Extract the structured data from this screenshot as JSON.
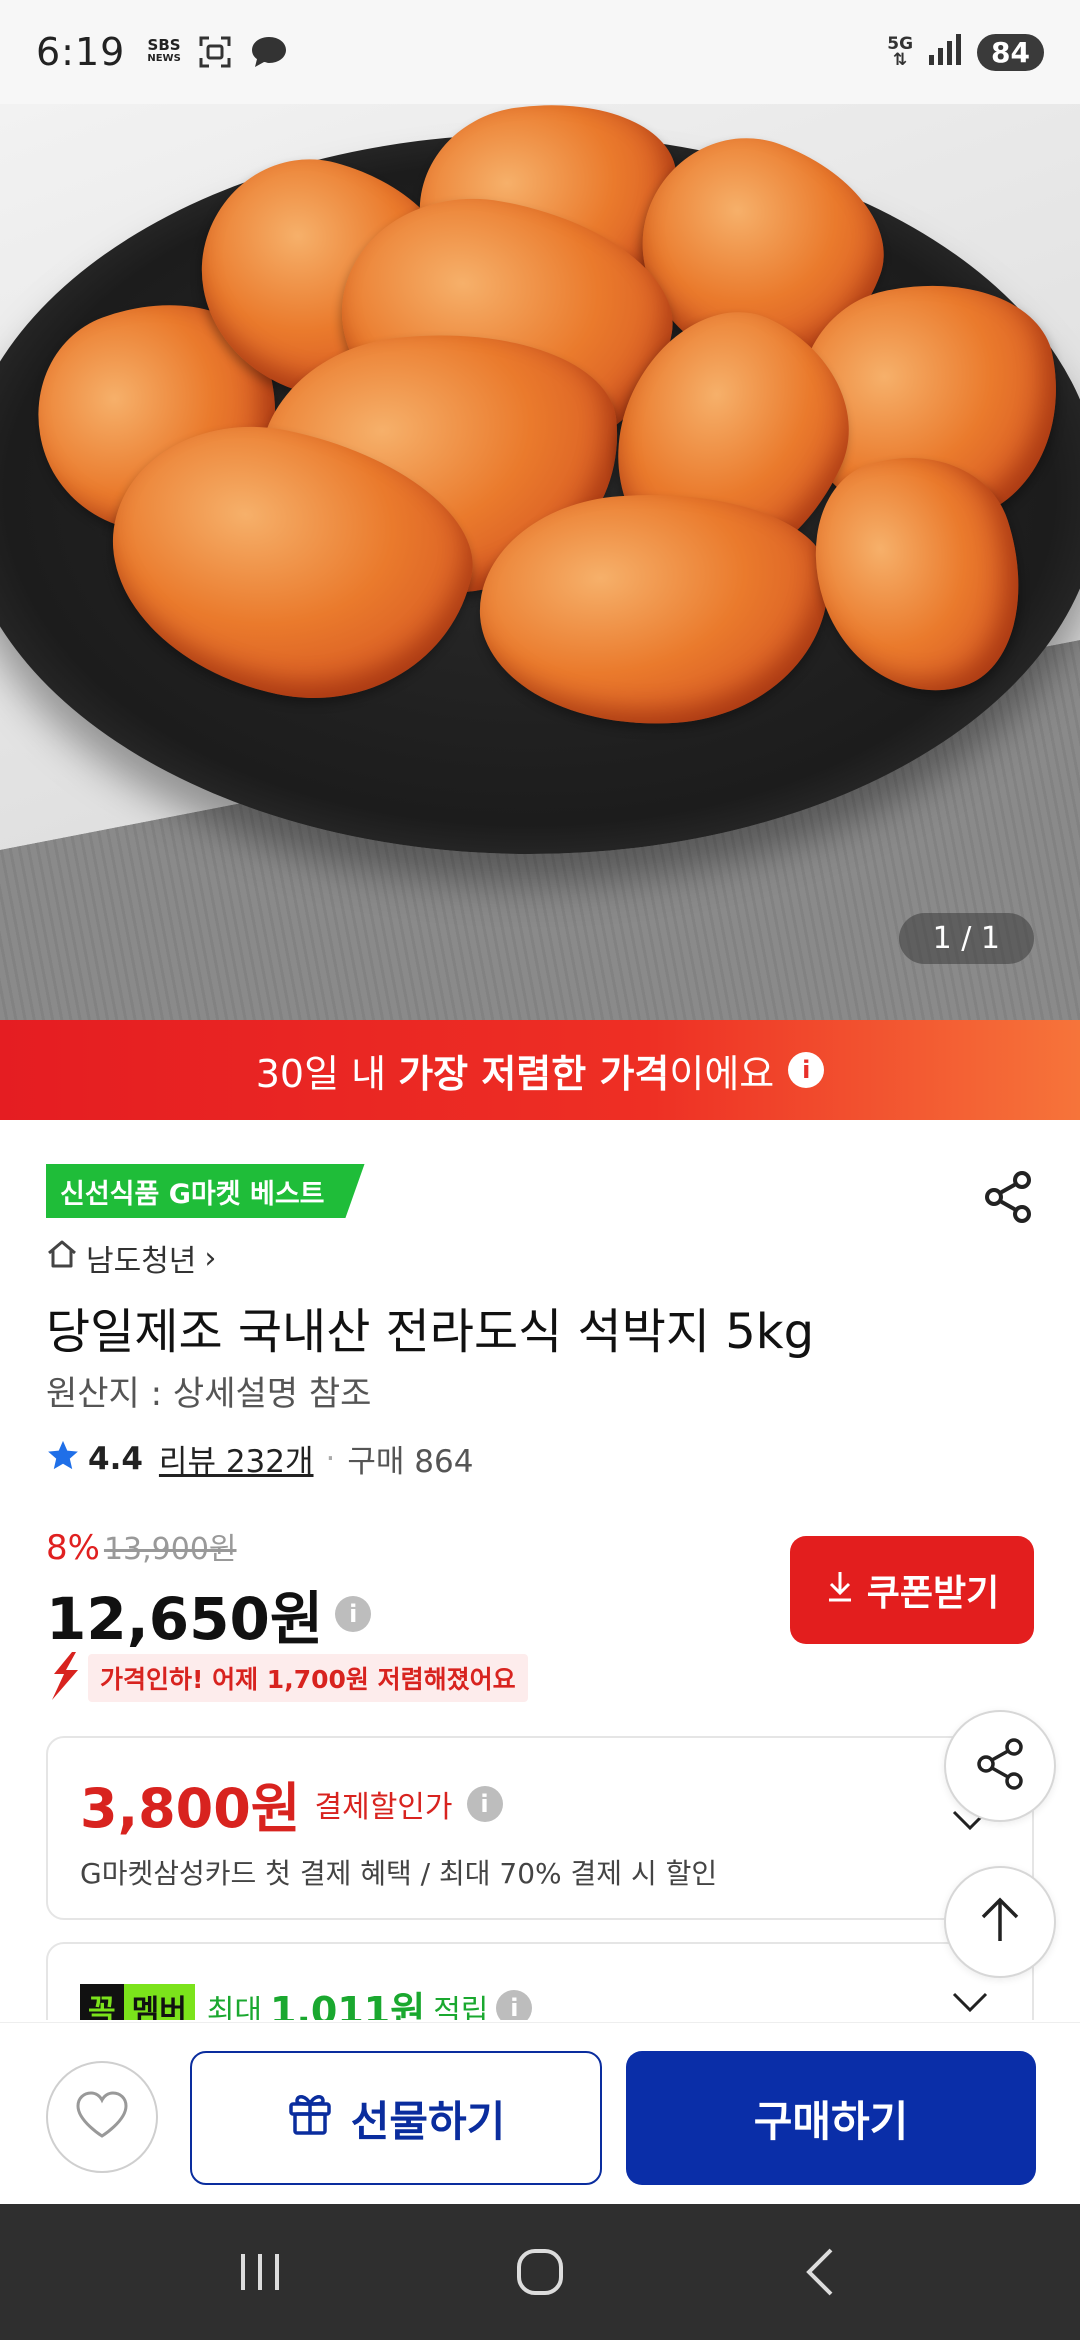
{
  "status_bar": {
    "time": "6:19",
    "sbs_line1": "SBS",
    "sbs_line2": "NEWS",
    "network": "5G",
    "battery": "84"
  },
  "hero": {
    "page_counter": "1 / 1"
  },
  "banner": {
    "prefix": "30일 내 ",
    "highlight": "가장 저렴한 가격",
    "suffix": "이에요",
    "info": "i"
  },
  "product": {
    "badge": "신선식품 G마켓 베스트",
    "store": "남도청년",
    "store_chevron": "›",
    "title": "당일제조 국내산 전라도식 석박지 5kg",
    "origin": "원산지 : 상세설명 참조",
    "rating": "4.4",
    "review": "리뷰 232개",
    "purchases": "구매 864",
    "discount_rate": "8%",
    "original_price": "13,900원",
    "sale_price": "12,650원",
    "price_drop": "가격인하! 어제 1,700원 저렴해졌어요",
    "coupon_button": "쿠폰받기",
    "info": "i"
  },
  "payment_card": {
    "amount": "3,800원",
    "label": "결제할인가",
    "description": "G마켓삼성카드 첫 결제 혜택 / 최대 70% 결제 시 할인"
  },
  "member_card": {
    "badge1": "꼭",
    "badge2": "멤버",
    "prefix": "최대",
    "amount": "1,011원",
    "suffix": "적립"
  },
  "actions": {
    "gift": "선물하기",
    "buy": "구매하기"
  },
  "colors": {
    "accent_red": "#e31e1e",
    "brand_blue": "#0a2ea8",
    "best_green": "#1fbd39",
    "member_green": "#7be31b"
  },
  "icons": [
    "share-icon",
    "home-icon",
    "star-icon",
    "info-icon",
    "download-icon",
    "chevron-down-icon",
    "arrow-up-icon",
    "heart-icon",
    "gift-icon",
    "recent-apps-icon",
    "home-nav-icon",
    "back-icon"
  ]
}
